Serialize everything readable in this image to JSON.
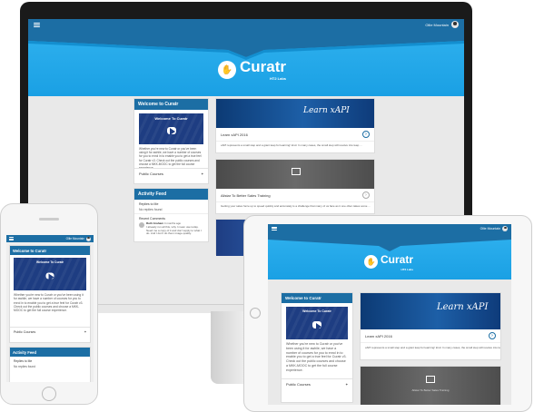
{
  "app": {
    "brand": "Curatr",
    "brand_sub": "HT2 Labs",
    "user_name": "Ollie Mountain",
    "user_name_phone": "Ollie Mountain"
  },
  "welcome": {
    "title": "Welcome to Curatr",
    "video_title": "Welcome To Curatr",
    "body": "Whether you're new to Curatr or you've been using it for awhile, we have a number of courses for you to enrol in to enable you to get a true feel for Curatr v3. Check out the public courses and choose a MKK-MOOC to get the full course experience.",
    "public_courses_label": "Public Courses"
  },
  "activity": {
    "title": "Activity Feed",
    "replies_label": "Replies to Me",
    "no_replies": "No replies found",
    "recent_label": "Recent Comments",
    "comment_author": "Ruth Graham",
    "comment_time": "4 months ago",
    "comment_text": "I already run all this, why I mean use today. Need me a copy of it and don't apply to what I do. And I don't do them image quality."
  },
  "courses": [
    {
      "banner_text": "Learn xAPI",
      "name": "Learn xAPI 2016",
      "description": "xAPI represents a small step and a giant leap for learning! kind. In many cases, the small step will resolve into leap ..."
    },
    {
      "banner_text": "",
      "name": "Allstar To Better Sales Training",
      "description": "Getting your sales force up to speed quickly and accurately is a challenge that many of us face as it one often takes some ..."
    }
  ],
  "icons": {
    "menu": "hamburger-menu-icon",
    "avatar": "user-avatar-icon",
    "go": "chevron-right-circle-icon",
    "plus": "plus-icon",
    "presentation": "presentation-board-icon",
    "brand": "lightbulb-logo-icon"
  },
  "colors": {
    "topbar": "#1c6ea4",
    "hero": "#1aa0e4",
    "card_header": "#1c6ea4"
  }
}
